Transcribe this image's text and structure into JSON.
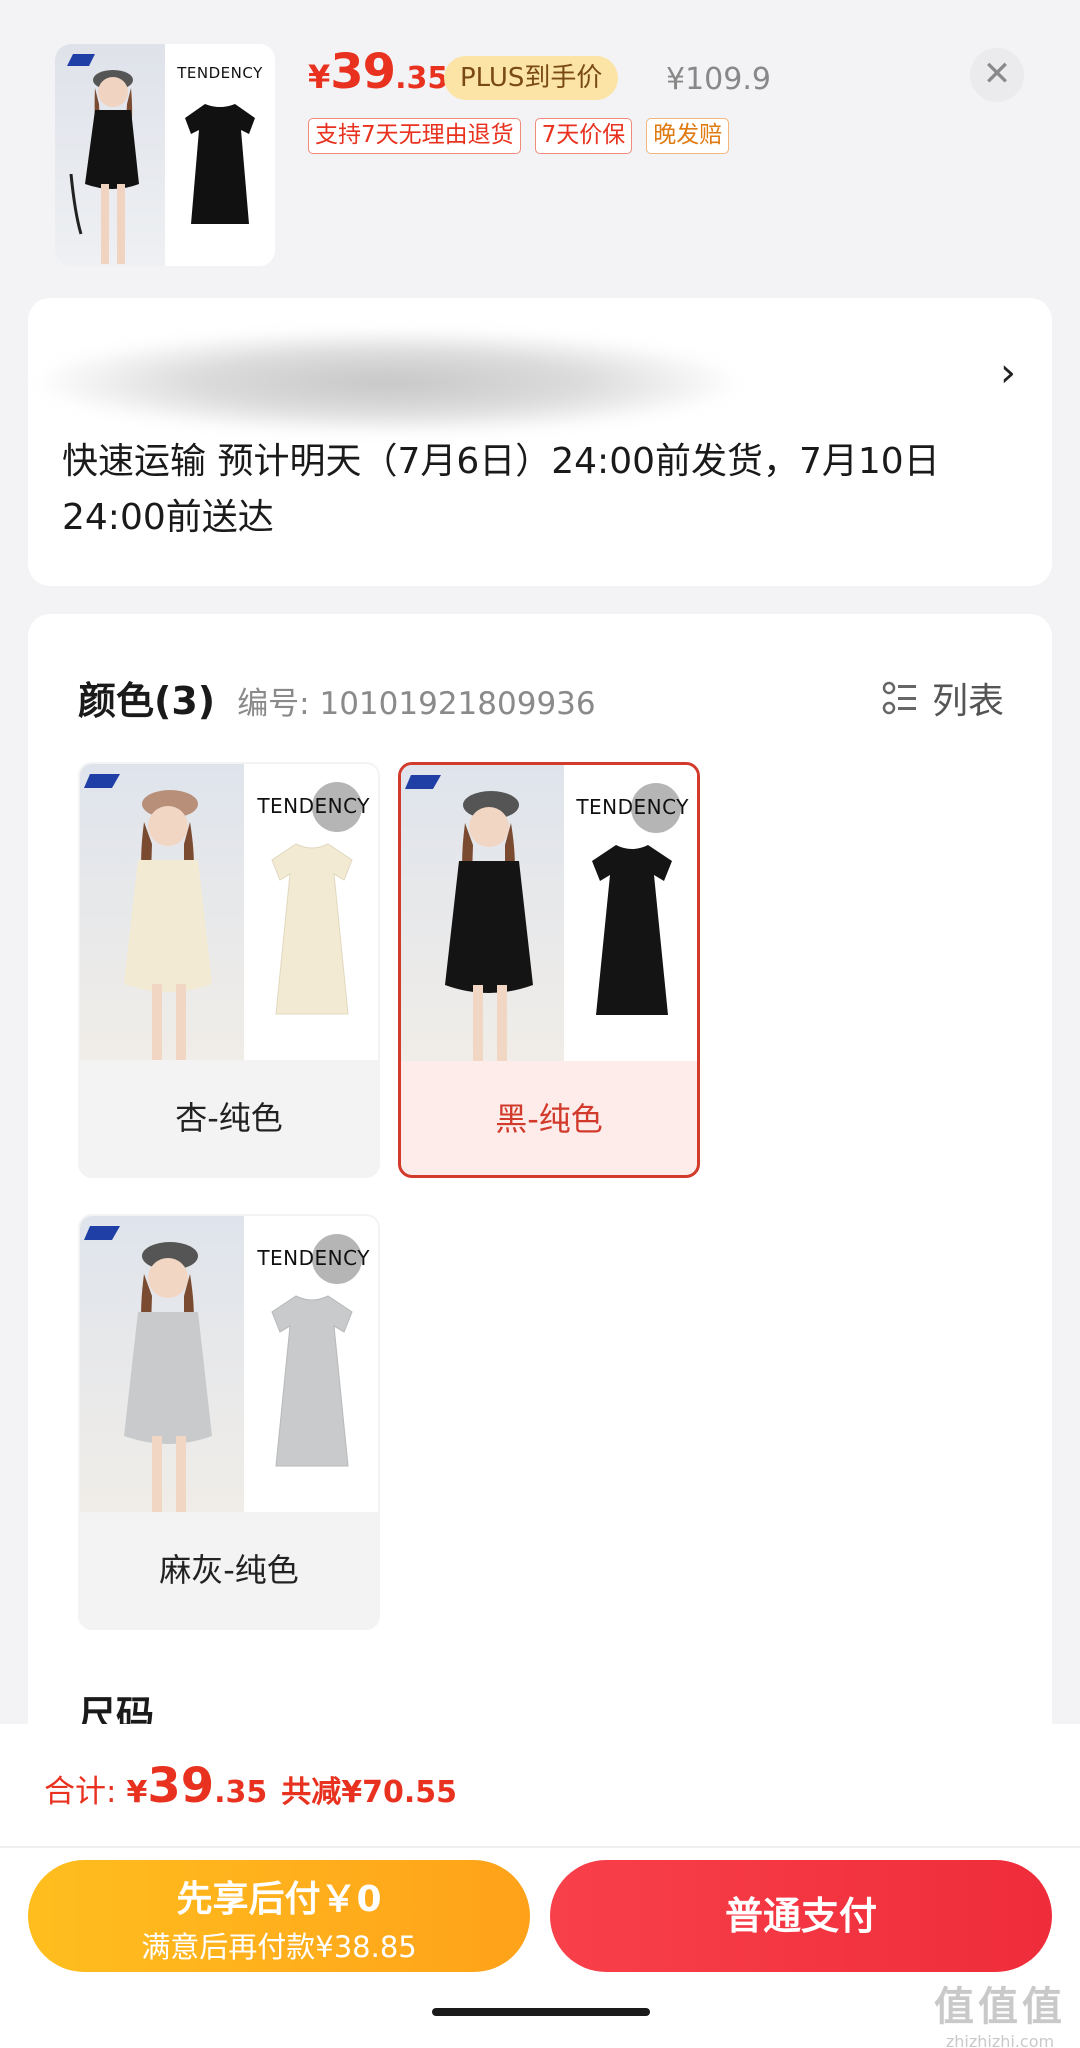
{
  "product": {
    "brand": "TENDENCY",
    "price_currency": "¥",
    "price_int": "39",
    "price_dec": ".35",
    "plus_badge": "PLUS到手价",
    "original_price": "¥109.9",
    "tags": [
      "支持7天无理由退货",
      "7天价保",
      "晚发赔"
    ]
  },
  "close_glyph": "✕",
  "address": {
    "arrow": "›",
    "shipping": "快速运输 预计明天（7月6日）24:00前发货，7月10日24:00前送达"
  },
  "sku": {
    "color_title": "颜色(3)",
    "code": "编号: 10101921809936",
    "list_label": "列表",
    "options": [
      {
        "label": "杏-纯色",
        "brand": "TENDENCY",
        "selected": false,
        "color": "#f3ead3"
      },
      {
        "label": "黑-纯色",
        "brand": "TENDENCY",
        "selected": true,
        "color": "#141414"
      },
      {
        "label": "麻灰-纯色",
        "brand": "TENDENCY",
        "selected": false,
        "color": "#c8cacc"
      }
    ],
    "size_title": "尺码"
  },
  "footer": {
    "total_label": "合计:",
    "total_cur": "¥",
    "total_int": "39",
    "total_dec": ".35",
    "discount": "共减¥70.55",
    "bnpl_line1": "先享后付￥0",
    "bnpl_line2": "满意后再付款¥38.85",
    "pay_label": "普通支付"
  },
  "watermark": {
    "logo": "值值值",
    "url": "zhizhizhi.com"
  },
  "colors": {
    "accent_red": "#e8321f",
    "selected_border": "#d23a2b",
    "bnpl_orange": "#ffa21a",
    "pay_red": "#ef2c3a"
  }
}
